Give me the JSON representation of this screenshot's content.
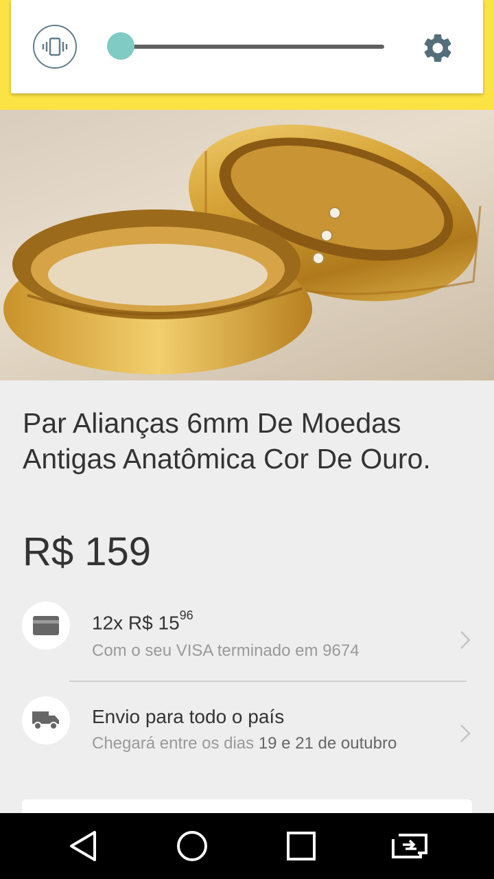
{
  "volume_panel": {
    "volume_level": 0.05,
    "vibrate_icon": "vibrate-icon",
    "settings_icon": "gear-icon",
    "accent_color": "#80cbc4"
  },
  "header": {
    "color": "#fbe245"
  },
  "product": {
    "title": "Par Alianças 6mm De Moedas Antigas Anatômica Cor De Ouro.",
    "price": "R$ 159"
  },
  "payment": {
    "installments_prefix": "12x R$ 15",
    "installments_cents": "96",
    "card_note": "Com o seu VISA terminado em 9674",
    "icon": "credit-card-icon"
  },
  "shipping": {
    "title": "Envio para todo o país",
    "note_prefix": "Chegará entre os dias ",
    "note_dates": "19 e 21 de outubro",
    "icon": "truck-icon"
  },
  "nav": {
    "back_icon": "back-icon",
    "home_icon": "home-icon",
    "recents_icon": "recents-icon",
    "switch_icon": "switch-apps-icon"
  }
}
